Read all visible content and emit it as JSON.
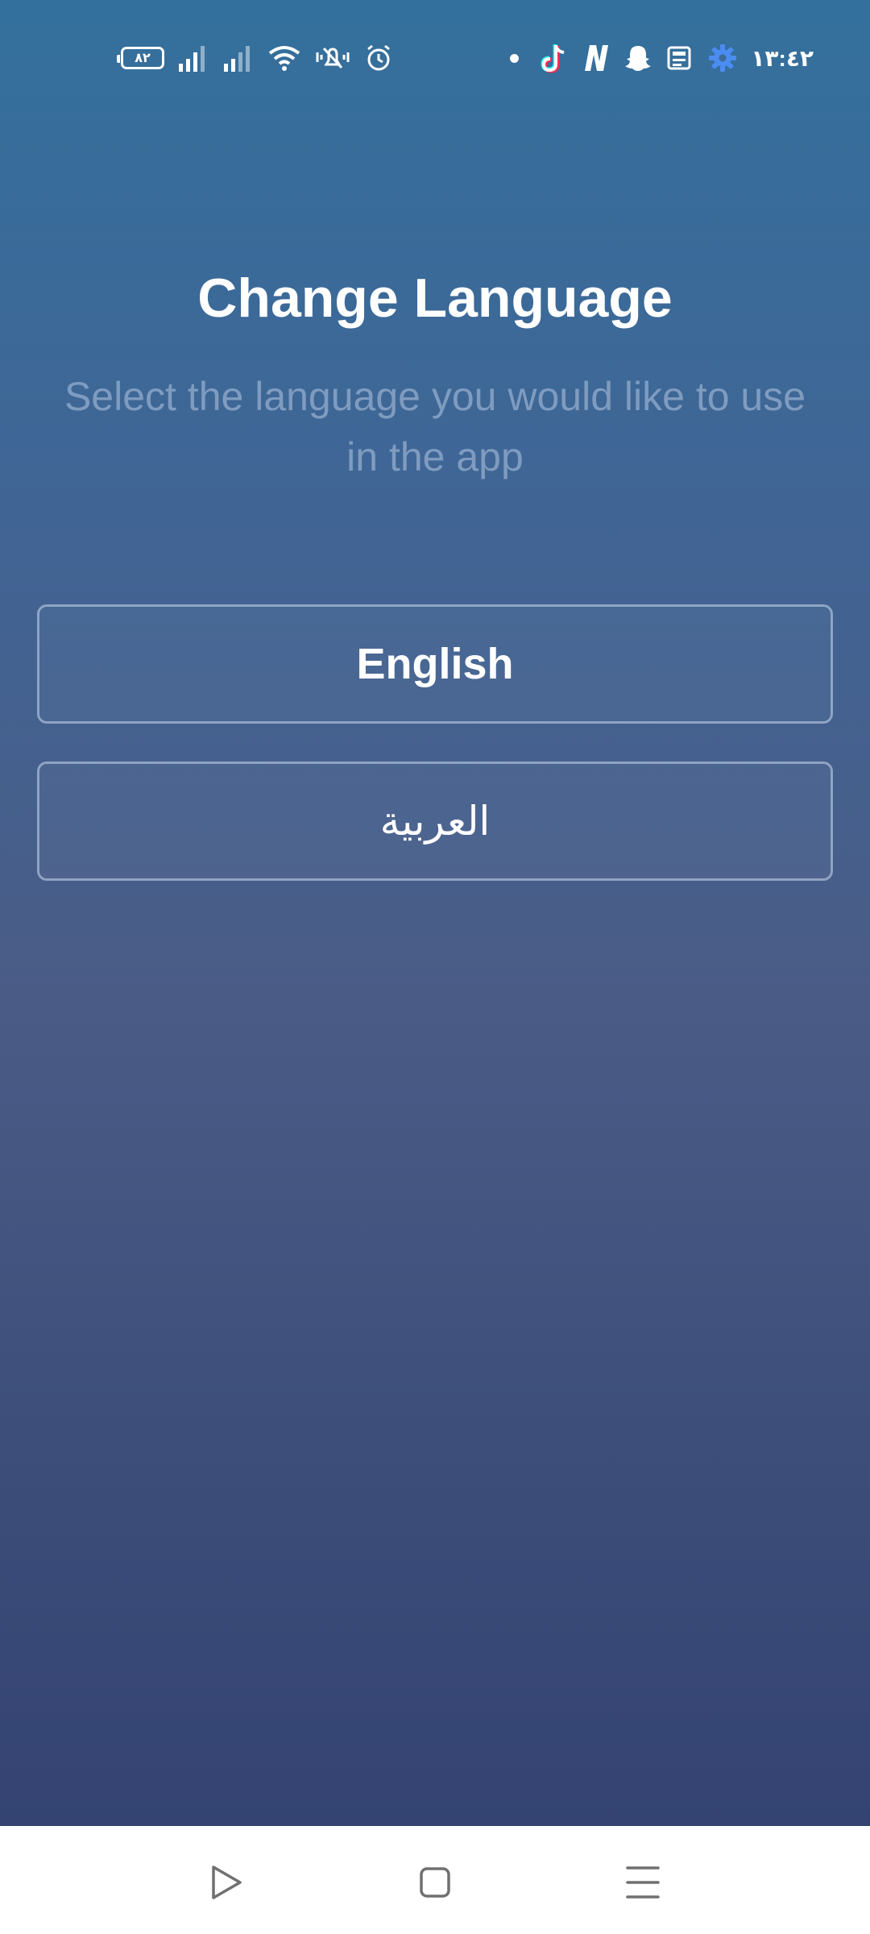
{
  "status_bar": {
    "battery_level": "٨٢",
    "time": "١٣:٤٢",
    "left_icons": [
      "battery-icon",
      "signal-icon",
      "signal-icon",
      "wifi-icon",
      "vibrate-icon",
      "alarm-icon"
    ],
    "right_icons": [
      "notification-dot-icon",
      "tiktok-icon",
      "n-app-icon",
      "snapchat-icon",
      "news-icon",
      "settings-gear-icon"
    ],
    "gear_color": "#4a8cf0"
  },
  "screen": {
    "title": "Change Language",
    "subtitle": "Select the language you would like to use in the app",
    "options": [
      {
        "label": "English"
      },
      {
        "label": "العربية"
      }
    ]
  },
  "nav_bar": {
    "items": [
      "back-triangle-icon",
      "home-square-icon",
      "recents-menu-icon"
    ]
  }
}
